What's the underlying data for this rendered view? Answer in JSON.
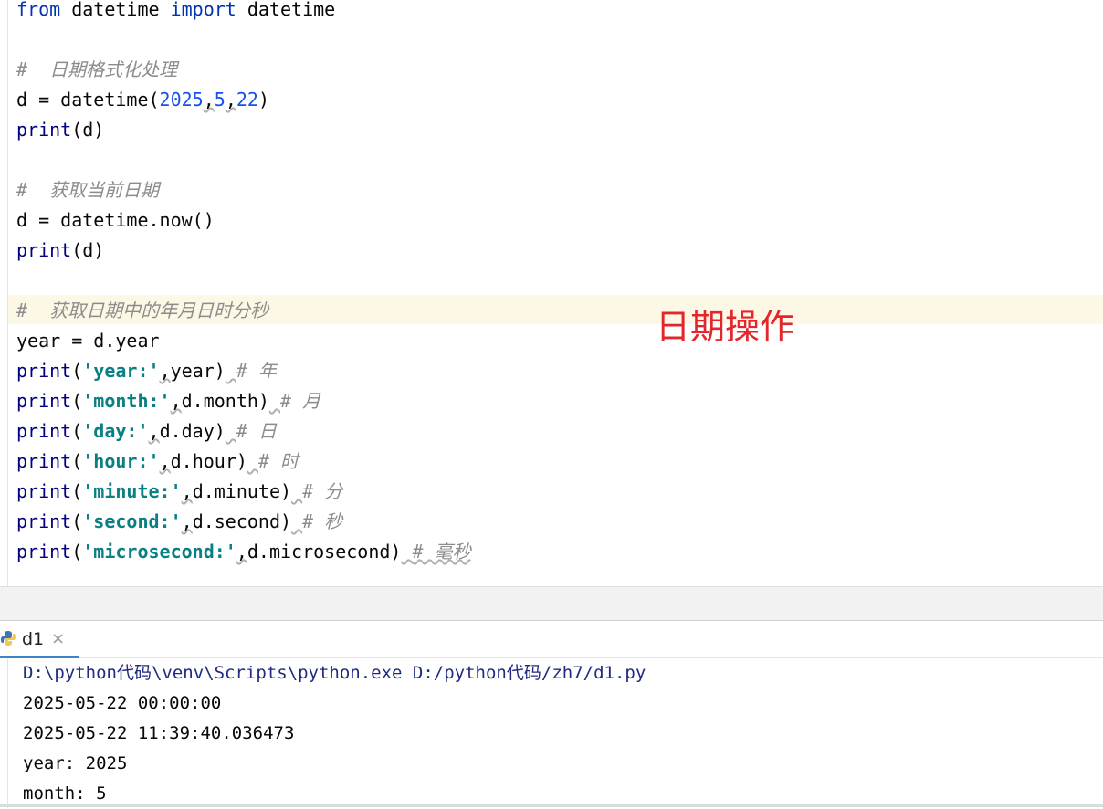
{
  "editor": {
    "code": {
      "l1_kw1": "from",
      "l1_mid": " datetime ",
      "l1_kw2": "import",
      "l1_end": " datetime",
      "c1": "#  日期格式化处理",
      "l4_a": "d = datetime(",
      "l4_n1": "2025",
      "l4_n2": "5",
      "l4_n3": "22",
      "l4_end": ")",
      "print": "print",
      "print_d": "(d)",
      "c2": "#  获取当前日期",
      "l8": "d = datetime.now()",
      "c3": "#  获取日期中的年月日时分秒",
      "l12": "year = d.year",
      "p_open": "(",
      "comma": ",",
      "s_year": "'year:'",
      "a_year": "year)",
      "cm_year": "# 年",
      "s_month": "'month:'",
      "a_month": "d.month)",
      "cm_month": "# 月",
      "s_day": "'day:'",
      "a_day": "d.day)",
      "cm_day": "# 日",
      "s_hour": "'hour:'",
      "a_hour": "d.hour)",
      "cm_hour": "# 时",
      "s_minute": "'minute:'",
      "a_minute": "d.minute)",
      "cm_minute": "# 分",
      "s_second": "'second:'",
      "a_second": "d.second)",
      "cm_second": "# 秒",
      "s_micro": "'microsecond:'",
      "a_micro": "d.microsecond)",
      "cm_micro": "# 毫秒"
    },
    "annotation": "日期操作"
  },
  "run_panel": {
    "tab_label": "d1",
    "tab_close": "×",
    "tab_icon": "python-icon",
    "output": [
      "D:\\python代码\\venv\\Scripts\\python.exe D:/python代码/zh7/d1.py",
      "2025-05-22 00:00:00",
      "2025-05-22 11:39:40.036473",
      "year: 2025",
      "month: 5"
    ]
  },
  "colors": {
    "keyword": "#0033b3",
    "string": "#0a7f84",
    "number": "#1750eb",
    "comment": "#8c8c8c",
    "annotation": "#e3262b",
    "tab_underline": "#4083c9"
  }
}
